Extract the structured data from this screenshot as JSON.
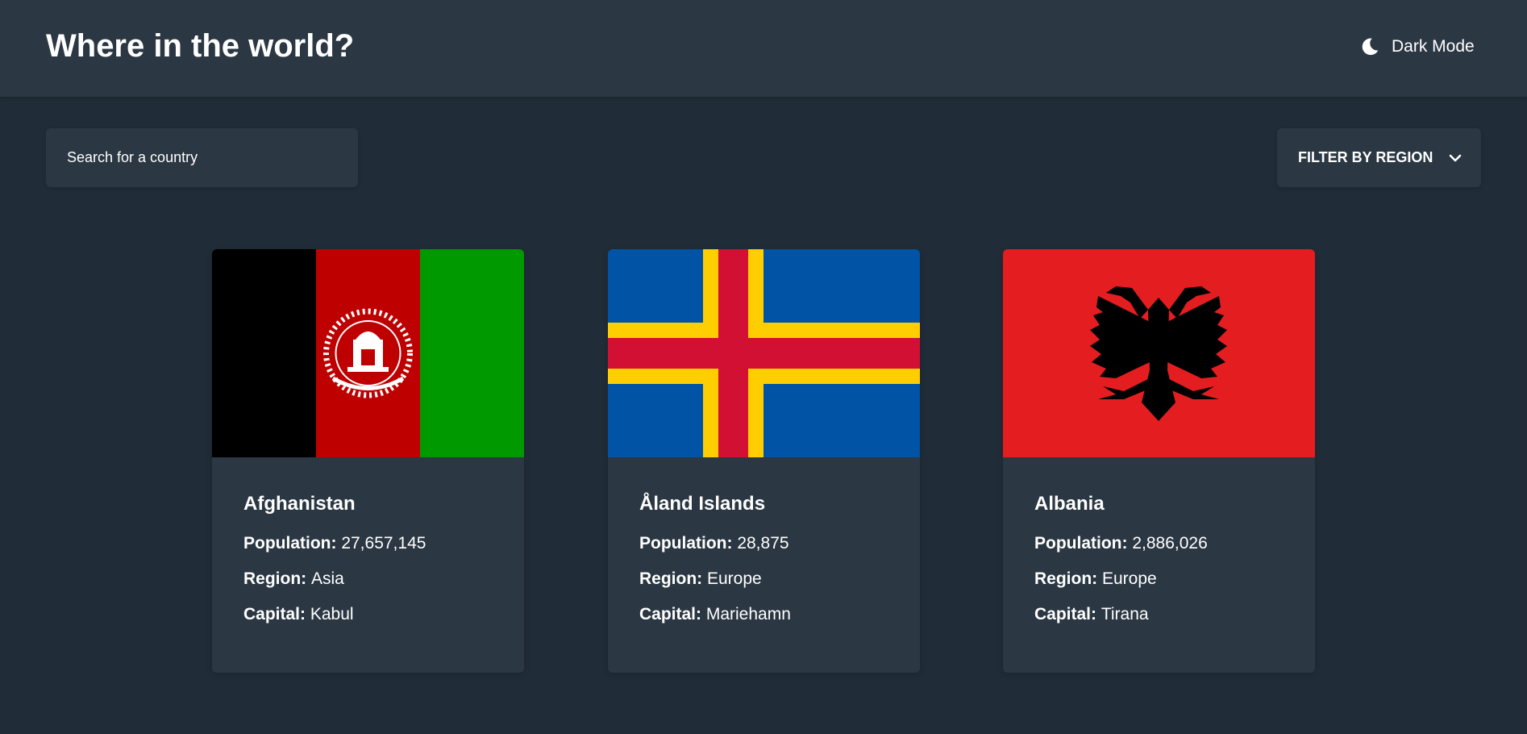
{
  "header": {
    "title": "Where in the world?",
    "theme_toggle_label": "Dark Mode",
    "theme_icon": "moon-icon"
  },
  "search": {
    "placeholder": "Search for a country",
    "value": ""
  },
  "filter": {
    "label": "FILTER BY REGION",
    "icon": "chevron-down-icon"
  },
  "labels": {
    "population": "Population:",
    "region": "Region:",
    "capital": "Capital:"
  },
  "countries": [
    {
      "name": "Afghanistan",
      "population": "27,657,145",
      "region": "Asia",
      "capital": "Kabul",
      "flag_colors": [
        "#000000",
        "#be0000",
        "#009900"
      ]
    },
    {
      "name": "Åland Islands",
      "population": "28,875",
      "region": "Europe",
      "capital": "Mariehamn",
      "flag_colors": [
        "#0053a5",
        "#ffce00",
        "#d21034"
      ]
    },
    {
      "name": "Albania",
      "population": "2,886,026",
      "region": "Europe",
      "capital": "Tirana",
      "flag_colors": [
        "#e41e20",
        "#000000"
      ]
    }
  ],
  "colors": {
    "background": "#202c37",
    "element": "#2b3743",
    "text": "#ffffff"
  }
}
